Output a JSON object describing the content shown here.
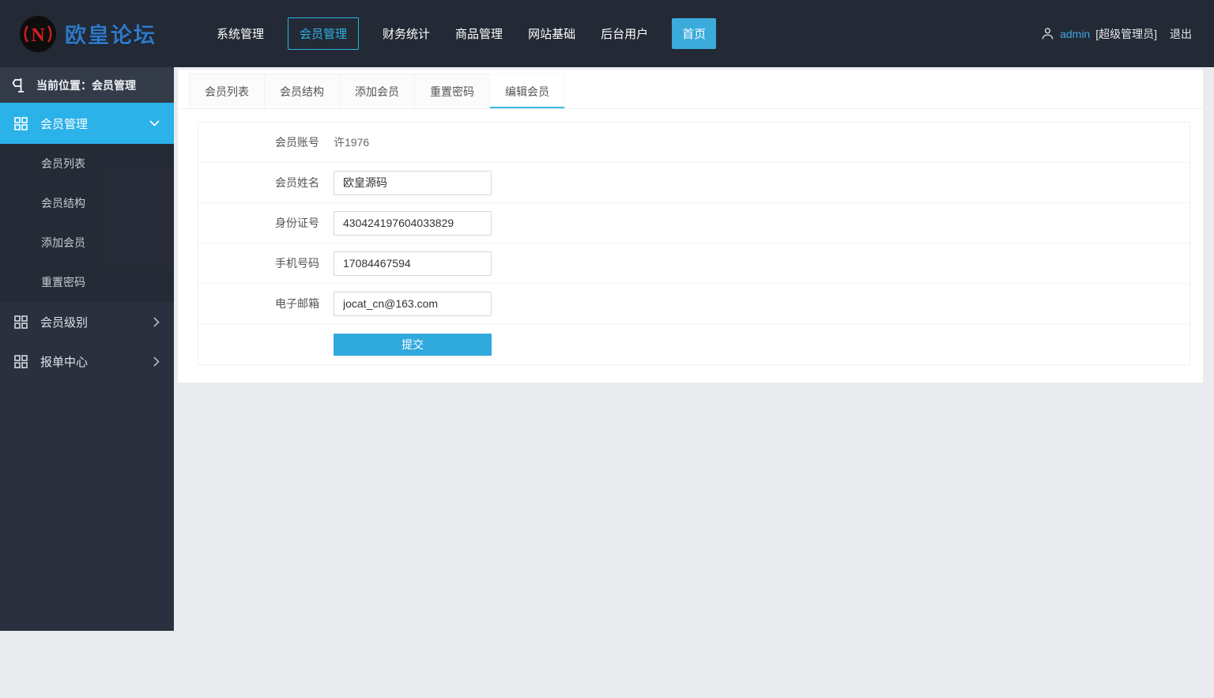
{
  "brand": {
    "name": "欧皇论坛",
    "logo_text": "N"
  },
  "nav": {
    "items": [
      {
        "label": "系统管理"
      },
      {
        "label": "会员管理"
      },
      {
        "label": "财务统计"
      },
      {
        "label": "商品管理"
      },
      {
        "label": "网站基础"
      },
      {
        "label": "后台用户"
      },
      {
        "label": "首页"
      }
    ]
  },
  "user": {
    "name": "admin",
    "role": "[超级管理员]",
    "logout_label": "退出"
  },
  "sidebar": {
    "breadcrumb": "当前位置：会员管理",
    "member_menu": {
      "label": "会员管理",
      "children": [
        {
          "label": "会员列表"
        },
        {
          "label": "会员结构"
        },
        {
          "label": "添加会员"
        },
        {
          "label": "重置密码"
        }
      ]
    },
    "other_menus": [
      {
        "label": "会员级别"
      },
      {
        "label": "报单中心"
      }
    ]
  },
  "tabs": {
    "items": [
      {
        "label": "会员列表"
      },
      {
        "label": "会员结构"
      },
      {
        "label": "添加会员"
      },
      {
        "label": "重置密码"
      },
      {
        "label": "编辑会员"
      }
    ],
    "active_index": 4
  },
  "form": {
    "account": {
      "label": "会员账号",
      "value": "许1976"
    },
    "name": {
      "label": "会员姓名",
      "value": "欧皇源码"
    },
    "id_number": {
      "label": "身份证号",
      "value": "430424197604033829"
    },
    "phone": {
      "label": "手机号码",
      "value": "17084467594"
    },
    "email": {
      "label": "电子邮箱",
      "value": "jocat_cn@163.com"
    },
    "submit_label": "提交"
  },
  "colors": {
    "header_bg": "#232935",
    "sidebar_bg": "#2a303d",
    "breadcrumb_bg": "#333b49",
    "sidebar_active": "#2bb2e8",
    "accent_button": "#30a9dc",
    "nav_outline": "#2eb3e3",
    "tab_underline": "#3db7e2",
    "content_bg": "#e9ebee",
    "brand_blue": "#2e78c6",
    "logo_red": "#d51f1f"
  }
}
